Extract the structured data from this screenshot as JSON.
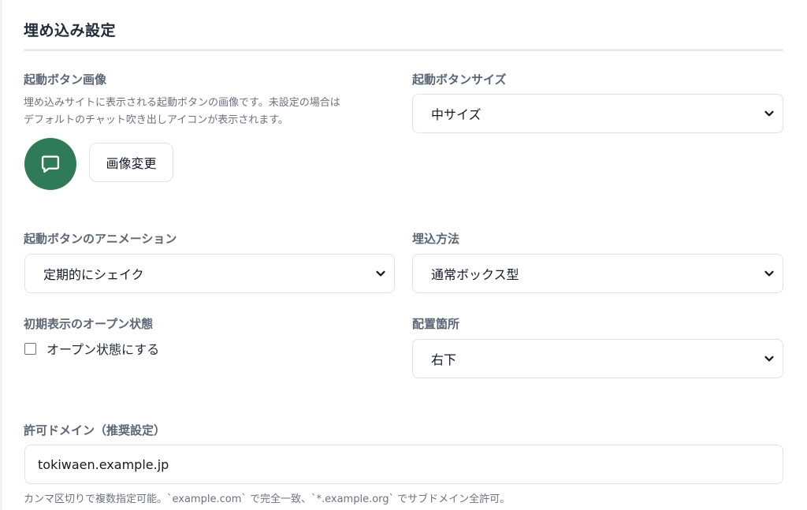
{
  "section": {
    "title": "埋め込み設定"
  },
  "launcher_image": {
    "label": "起動ボタン画像",
    "description_line1": "埋め込みサイトに表示される起動ボタンの画像です。未設定の場合は",
    "description_line2": "デフォルトのチャット吹き出しアイコンが表示されます。",
    "icon": "chat-bubble-icon",
    "change_button": "画像変更",
    "accent_color": "#2f7a58"
  },
  "launcher_size": {
    "label": "起動ボタンサイズ",
    "selected": "中サイズ"
  },
  "launcher_animation": {
    "label": "起動ボタンのアニメーション",
    "selected": "定期的にシェイク"
  },
  "embed_method": {
    "label": "埋込方法",
    "selected": "通常ボックス型"
  },
  "initial_open": {
    "label": "初期表示のオープン状態",
    "checkbox_label": "オープン状態にする",
    "checked": false
  },
  "placement": {
    "label": "配置箇所",
    "selected": "右下"
  },
  "allowed_domains": {
    "label": "許可ドメイン（推奨設定）",
    "value": "tokiwaen.example.jp",
    "hint": "カンマ区切りで複数指定可能。`example.com` で完全一致、`*.example.org` でサブドメイン全許可。"
  }
}
